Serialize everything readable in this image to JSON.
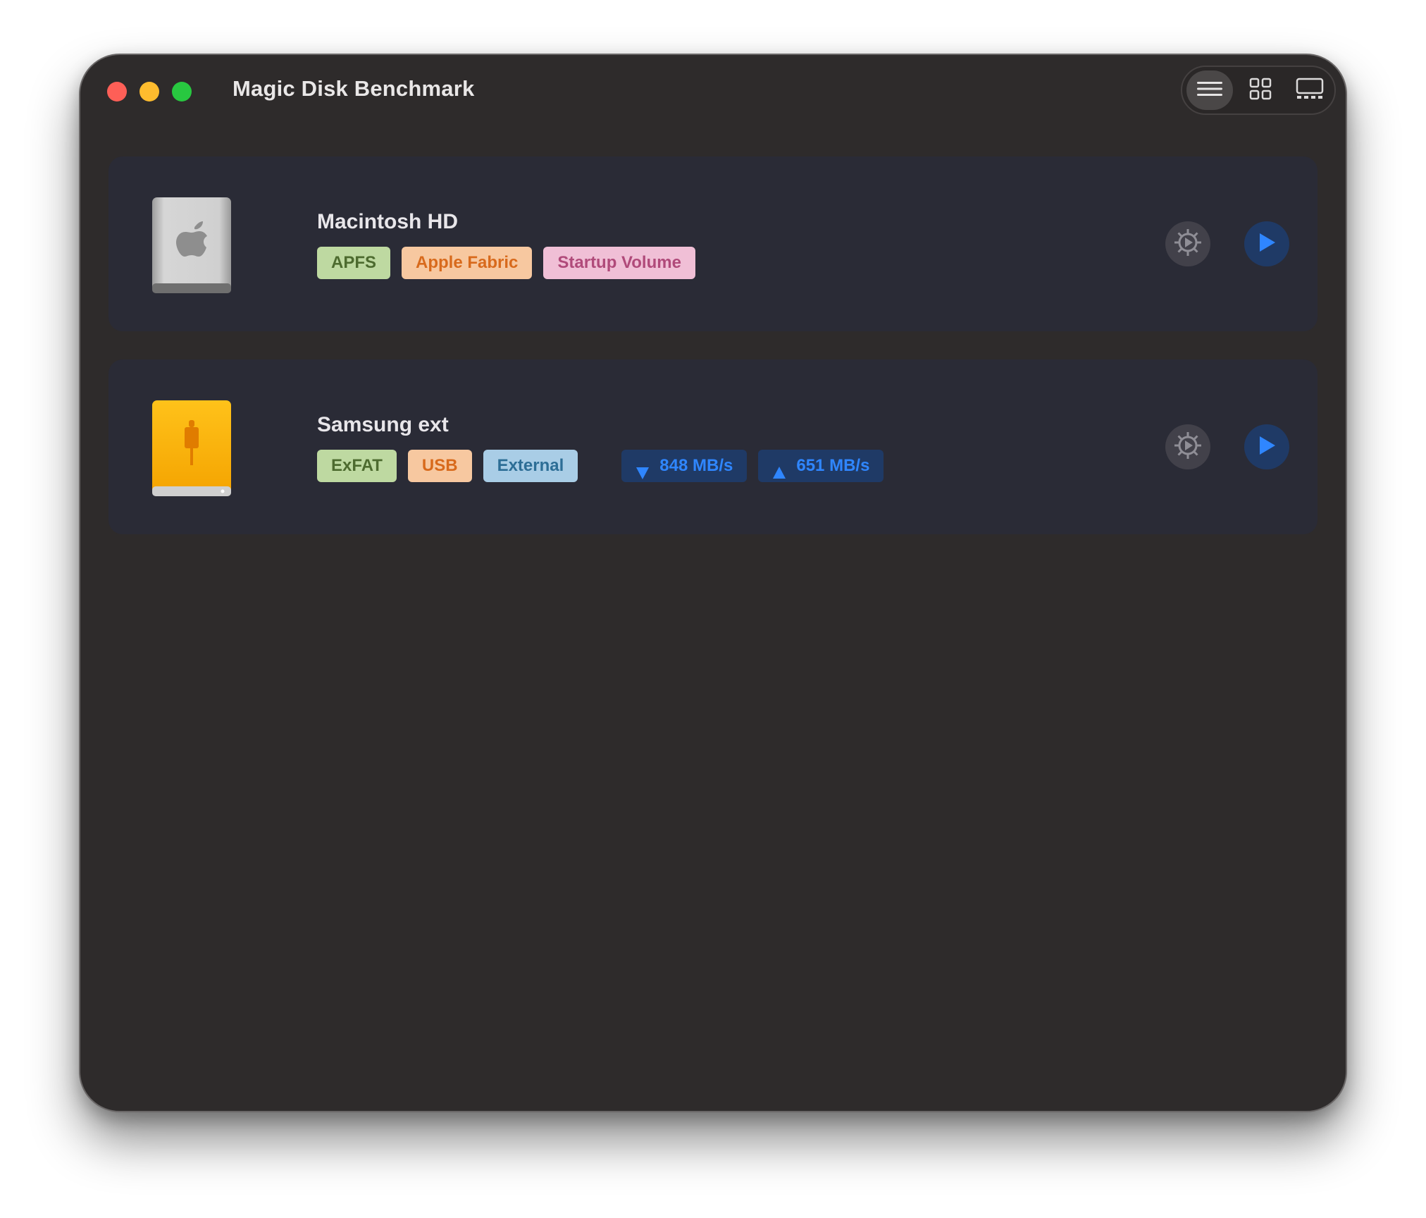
{
  "window": {
    "title": "Magic Disk Benchmark"
  },
  "view_switcher": {
    "options": [
      {
        "icon": "list-view-icon",
        "active": true
      },
      {
        "icon": "grid-view-icon",
        "active": false
      },
      {
        "icon": "gallery-view-icon",
        "active": false
      }
    ]
  },
  "disks": [
    {
      "name": "Macintosh HD",
      "icon": "internal-drive-icon",
      "tags": [
        "APFS",
        "Apple Fabric",
        "Startup Volume"
      ],
      "speeds": null
    },
    {
      "name": "Samsung ext",
      "icon": "external-usb-drive-icon",
      "tags": [
        "ExFAT",
        "USB",
        "External"
      ],
      "speeds": {
        "read": "848 MB/s",
        "write": "651 MB/s"
      }
    }
  ],
  "colors": {
    "window_bg": "#2e2b2b",
    "card_bg": "#2a2b36",
    "accent_blue": "#2f86ff",
    "tag_green_bg": "#bed9a1",
    "tag_orange_bg": "#f7c8a0",
    "tag_pink_bg": "#f0bfd6",
    "tag_blue_bg": "#a9cde6"
  }
}
